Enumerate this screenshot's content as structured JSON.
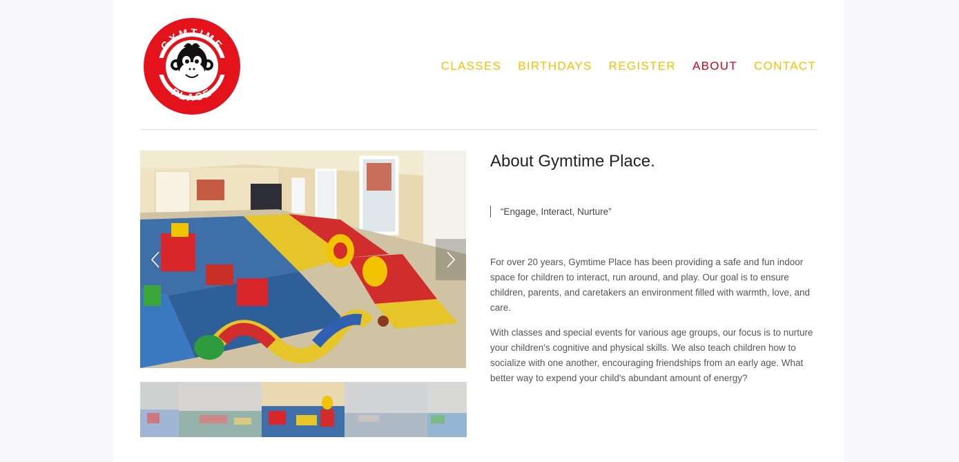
{
  "brand": {
    "logo_text_top": "GYMTIME",
    "logo_text_bottom": "PLACE",
    "logo_color": "#e4131b"
  },
  "nav": {
    "items": [
      {
        "label": "CLASSES",
        "active": false
      },
      {
        "label": "BIRTHDAYS",
        "active": false
      },
      {
        "label": "REGISTER",
        "active": false
      },
      {
        "label": "ABOUT",
        "active": true
      },
      {
        "label": "CONTACT",
        "active": false
      }
    ],
    "color": "#f2c300",
    "active_color": "#d0021b"
  },
  "gallery": {
    "slide_count": 5,
    "active_thumb_index": 2
  },
  "about": {
    "heading": "About Gymtime Place.",
    "quote": "“Engage, Interact, Nurture”",
    "paragraphs": [
      "For over 20 years, Gymtime Place has been providing a safe and fun indoor space for children to interact, run around, and play. Our goal is to ensure children, parents, and caretakers an environment filled with warmth, love, and care.",
      "With classes and special events for various age groups, our focus is to nurture your children's cognitive and physical skills. We also teach children how to socialize with one another, encouraging friendships from an early age. What better way to expend your child's abundant amount of energy?"
    ]
  }
}
